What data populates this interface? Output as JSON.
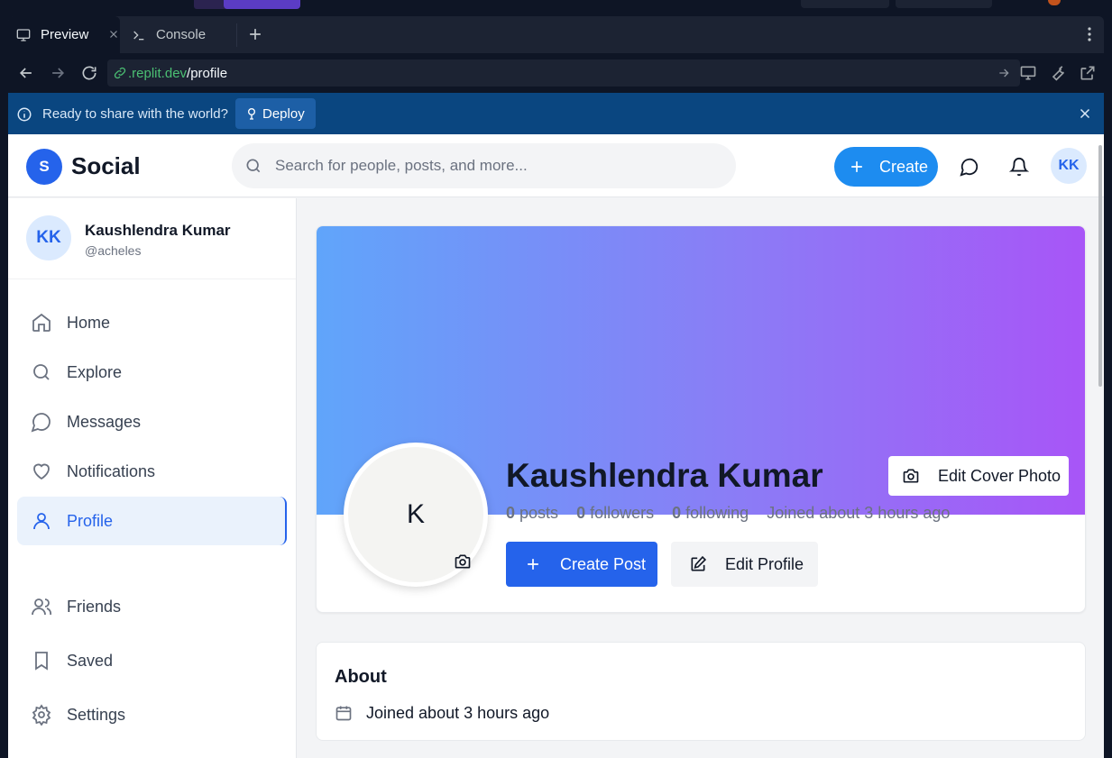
{
  "browser": {
    "tabs": [
      {
        "label": "Preview",
        "icon": "monitor-icon"
      },
      {
        "label": "Console",
        "icon": "terminal-icon"
      }
    ],
    "url_host": ".replit.dev",
    "url_path": "/profile"
  },
  "banner": {
    "message": "Ready to share with the world?",
    "deploy_label": "Deploy"
  },
  "header": {
    "logo_letter": "S",
    "brand": "Social",
    "search_placeholder": "Search for people, posts, and more...",
    "create_label": "Create",
    "avatar_initials": "KK"
  },
  "sidebar": {
    "user": {
      "initials": "KK",
      "name": "Kaushlendra Kumar",
      "handle": "@acheles"
    },
    "items": [
      {
        "label": "Home",
        "icon": "home-icon"
      },
      {
        "label": "Explore",
        "icon": "search-icon"
      },
      {
        "label": "Messages",
        "icon": "message-icon"
      },
      {
        "label": "Notifications",
        "icon": "heart-icon"
      },
      {
        "label": "Profile",
        "icon": "user-icon",
        "active": true
      },
      {
        "label": "Friends",
        "icon": "users-icon"
      },
      {
        "label": "Saved",
        "icon": "bookmark-icon"
      },
      {
        "label": "Settings",
        "icon": "gear-icon"
      }
    ]
  },
  "profile": {
    "initial": "K",
    "name": "Kaushlendra Kumar",
    "edit_cover_label": "Edit Cover Photo",
    "stats": {
      "posts_count": "0",
      "posts_label": "posts",
      "followers_count": "0",
      "followers_label": "followers",
      "following_count": "0",
      "following_label": "following",
      "joined": "Joined about 3 hours ago"
    },
    "create_post_label": "Create Post",
    "edit_profile_label": "Edit Profile"
  },
  "about": {
    "title": "About",
    "joined": "Joined about 3 hours ago"
  },
  "colors": {
    "brand_blue": "#2563eb",
    "create_blue": "#1d8cf0",
    "cover_start": "#60a5fa",
    "cover_end": "#a855f7",
    "banner_bg": "#0a4680"
  }
}
